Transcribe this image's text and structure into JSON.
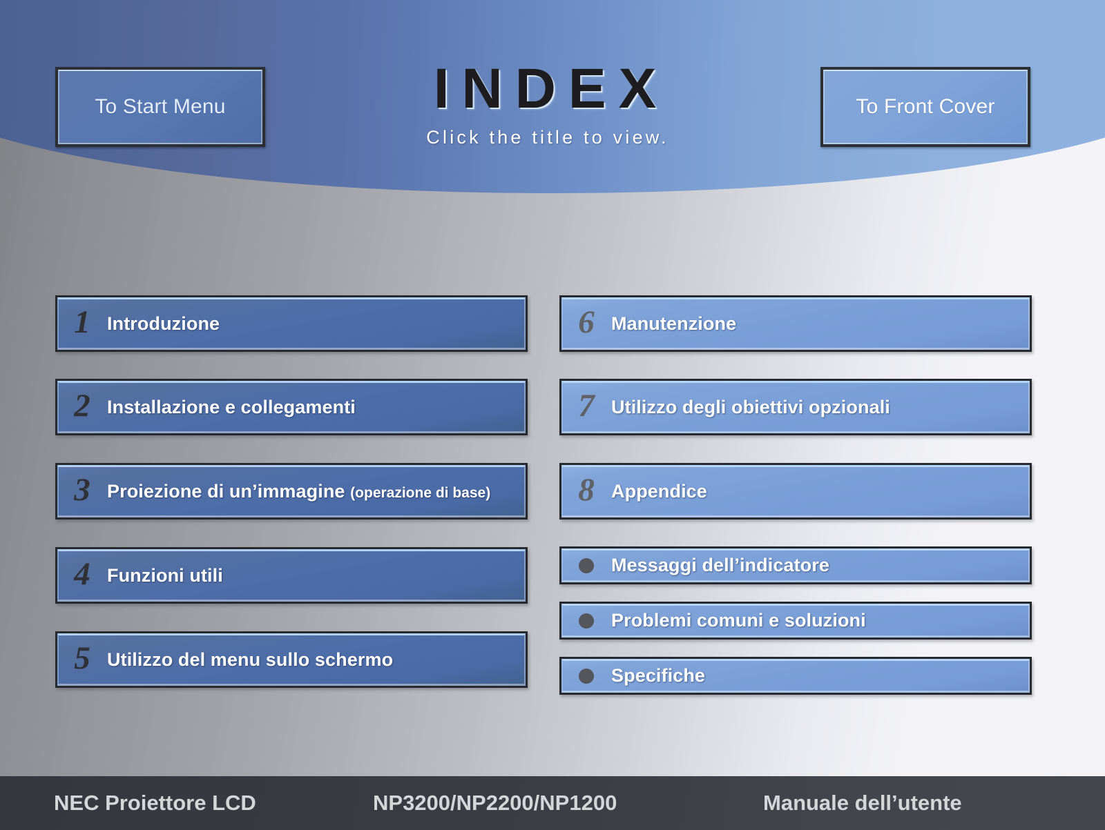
{
  "header": {
    "title": "INDEX",
    "subtitle": "Click the title to view.",
    "start_menu_button": "To Start Menu",
    "front_cover_button": "To Front Cover",
    "gradient_from": "#4b6192",
    "gradient_to": "#90b2e0"
  },
  "menu": {
    "left_column": [
      {
        "number": "1",
        "label": "Introduzione",
        "sub": ""
      },
      {
        "number": "2",
        "label": "Installazione e collegamenti",
        "sub": ""
      },
      {
        "number": "3",
        "label": "Proiezione di un’immagine",
        "sub": "(operazione di base)"
      },
      {
        "number": "4",
        "label": "Funzioni utili",
        "sub": ""
      },
      {
        "number": "5",
        "label": "Utilizzo del menu sullo schermo",
        "sub": ""
      }
    ],
    "right_column": [
      {
        "number": "6",
        "label": "Manutenzione",
        "sub": ""
      },
      {
        "number": "7",
        "label": "Utilizzo degli obiettivi opzionali",
        "sub": ""
      },
      {
        "number": "8",
        "label": "Appendice",
        "sub": ""
      },
      {
        "number": "●",
        "label": "Messaggi dell’indicatore",
        "sub": ""
      },
      {
        "number": "●",
        "label": "Problemi comuni e soluzioni",
        "sub": ""
      },
      {
        "number": "●",
        "label": "Specifiche",
        "sub": ""
      }
    ],
    "left_button_color": "#4e6ea9",
    "right_button_color": "#7ba0d8"
  },
  "footer": {
    "brand": "NEC Proiettore LCD",
    "model": "NP3200/NP2200/NP1200",
    "manual": "Manuale dell’utente",
    "background": "#393c42",
    "text_color": "#d5d6da"
  }
}
